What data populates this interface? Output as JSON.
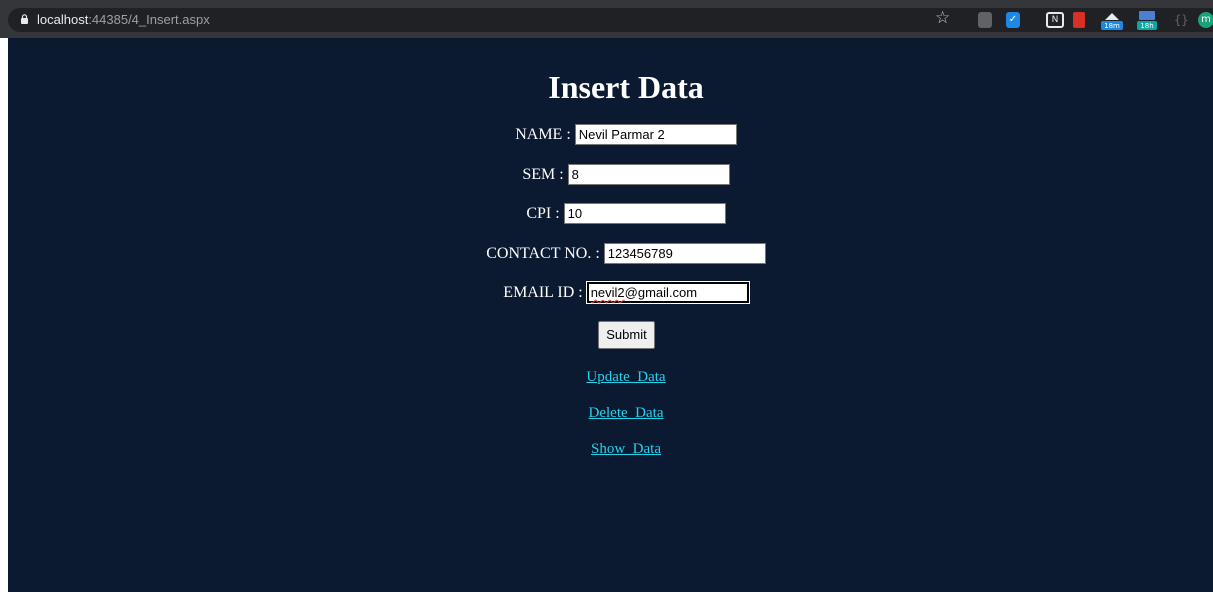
{
  "browser": {
    "url_host": "localhost",
    "url_path": ":44385/4_Insert.aspx",
    "ext_badges": [
      "18m",
      "18h"
    ]
  },
  "page": {
    "title": "Insert Data",
    "fields": [
      {
        "label": "NAME :",
        "value": "Nevil Parmar 2"
      },
      {
        "label": "SEM :",
        "value": "8"
      },
      {
        "label": "CPI :",
        "value": "10"
      },
      {
        "label": "CONTACT NO. :",
        "value": "123456789"
      },
      {
        "label": "EMAIL ID :",
        "value_underlined": "nevil2",
        "value_rest": "@gmail.com"
      }
    ],
    "submit_label": "Submit",
    "links": [
      "Update_Data",
      "Delete_Data",
      "Show_Data"
    ]
  },
  "colors": {
    "page_bg": "#0b1931",
    "link": "#22d3ee",
    "chrome_bg": "#35363a"
  }
}
